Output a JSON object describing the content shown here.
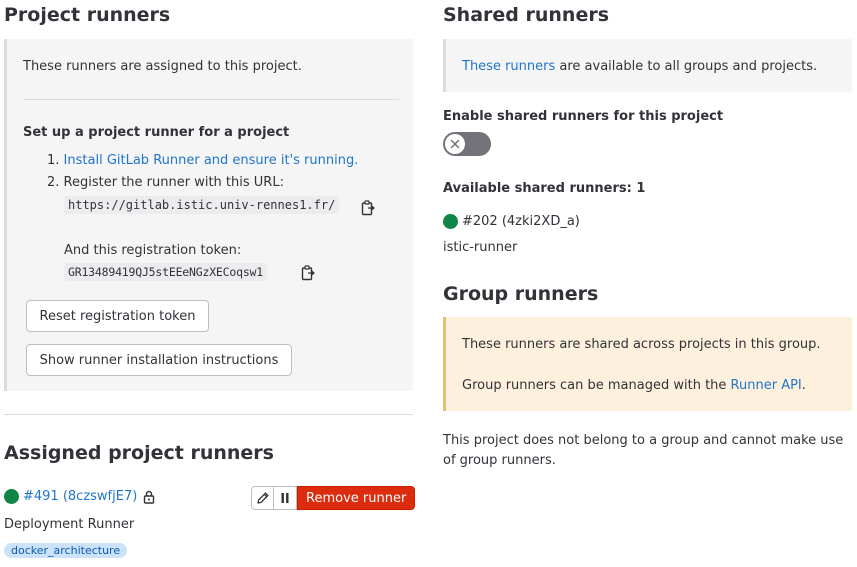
{
  "project_runners": {
    "title": "Project runners",
    "description": "These runners are assigned to this project.",
    "setup_title": "Set up a project runner for a project",
    "step1_num": "1.",
    "step1_link": "Install GitLab Runner and ensure it's running.",
    "step2_num": "2.",
    "step2_text": "Register the runner with this URL:",
    "url": "https://gitlab.istic.univ-rennes1.fr/",
    "token_label": "And this registration token:",
    "token": "GR13489419QJ5stEEeNGzXECoqsw1",
    "reset_button": "Reset registration token",
    "install_button": "Show runner installation instructions"
  },
  "assigned_runners": {
    "title": "Assigned project runners",
    "runner": {
      "id_label": "#491 (8czswfjE7)",
      "status_color": "#108548",
      "description": "Deployment Runner",
      "tag": "docker_architecture",
      "remove_label": "Remove runner"
    }
  },
  "shared_runners": {
    "title": "Shared runners",
    "info_link": "These runners",
    "info_rest": " are available to all groups and projects.",
    "enable_label": "Enable shared runners for this project",
    "toggle_enabled": false,
    "available_label": "Available shared runners: 1",
    "runner": {
      "id_label": "#202 (4zki2XD_a)",
      "status_color": "#108548",
      "name": "istic-runner"
    }
  },
  "group_runners": {
    "title": "Group runners",
    "line1": "These runners are shared across projects in this group.",
    "line2_prefix": "Group runners can be managed with the ",
    "line2_link": "Runner API",
    "line2_suffix": ".",
    "no_group_text": "This project does not belong to a group and cannot make use of group runners."
  },
  "colors": {
    "link": "#1f75cb",
    "danger": "#dd2b0e",
    "online": "#108548",
    "warning_bg": "#fdf1dd"
  }
}
